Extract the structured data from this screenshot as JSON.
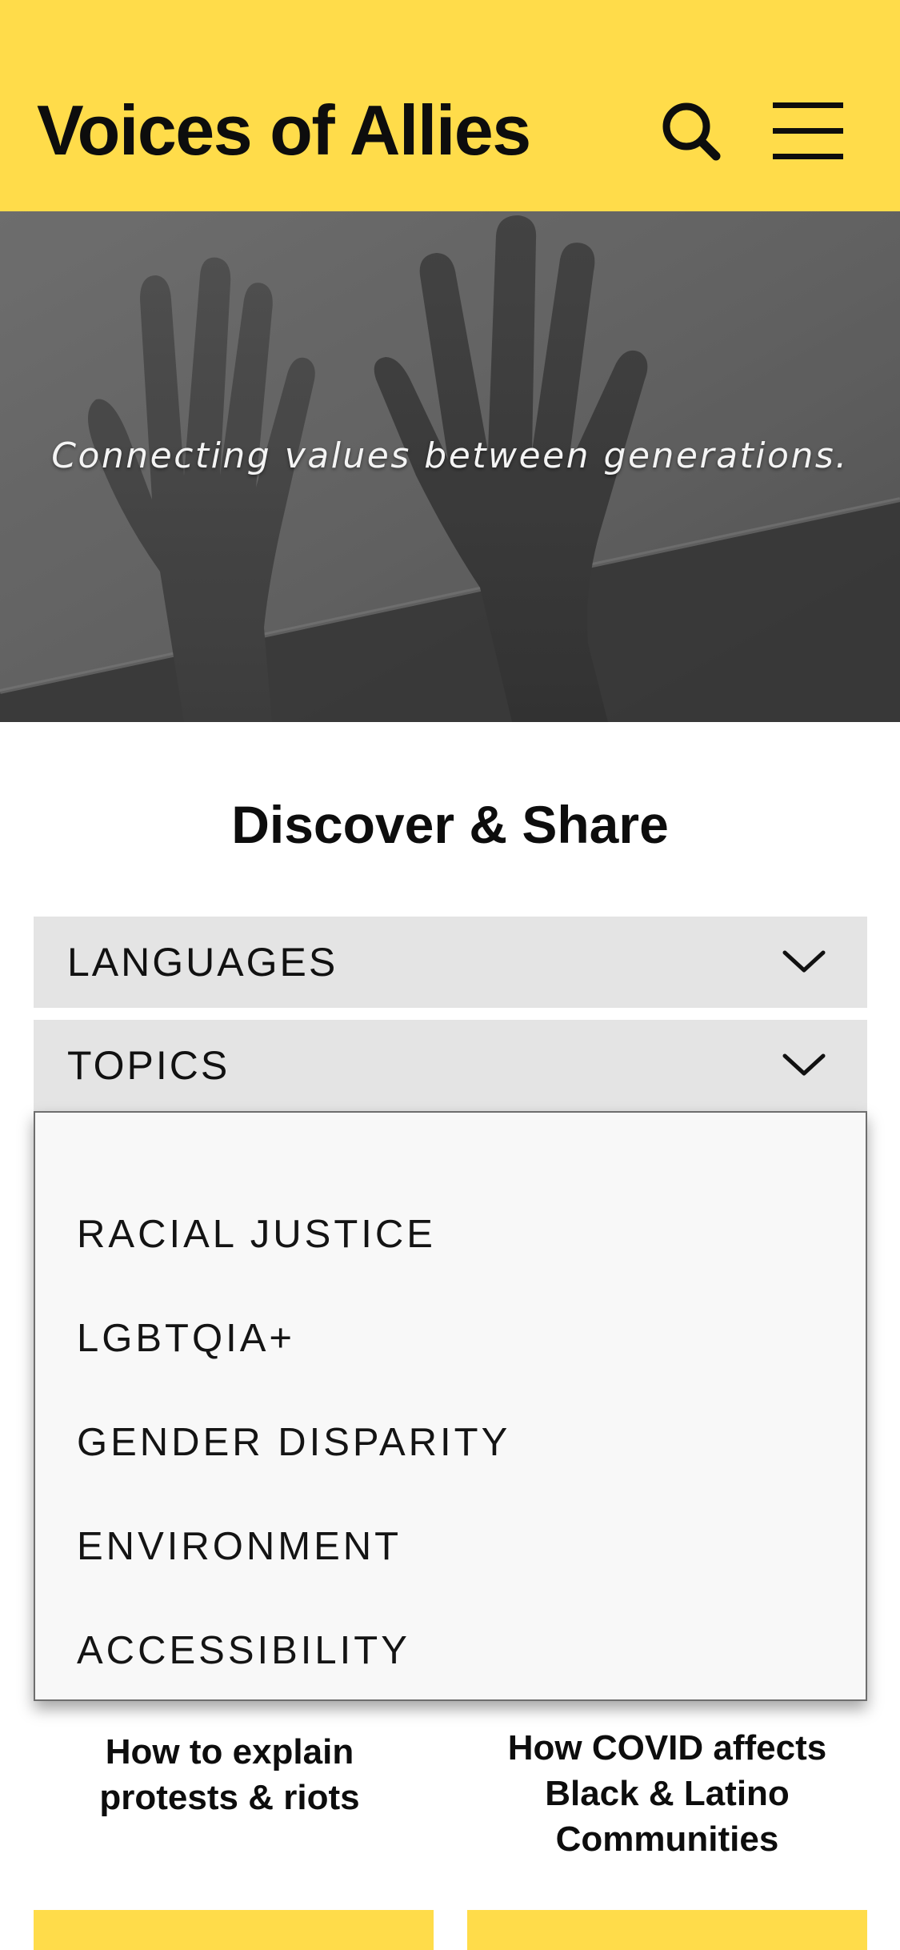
{
  "header": {
    "brand": "Voices of Allies",
    "search_icon": "search-icon",
    "menu_icon": "hamburger-menu-icon",
    "background_color": "#FFDC4A"
  },
  "hero": {
    "tagline": "Connecting values between generations.",
    "image": "grayscale photo of two raised hands"
  },
  "discover": {
    "title": "Discover & Share",
    "filters": [
      {
        "label": "LANGUAGES",
        "icon": "chevron-down-icon"
      },
      {
        "label": "TOPICS",
        "icon": "chevron-down-icon"
      }
    ],
    "topics_dropdown": {
      "open": true,
      "options": [
        "RACIAL JUSTICE",
        "LGBTQIA+",
        "GENDER DISPARITY",
        "ENVIRONMENT",
        "ACCESSIBILITY"
      ]
    }
  },
  "cards": [
    {
      "title_lines": [
        "How to explain",
        "protests & riots"
      ]
    },
    {
      "title_lines": [
        "How COVID affects",
        "Black & Latino",
        "Communities"
      ]
    }
  ]
}
